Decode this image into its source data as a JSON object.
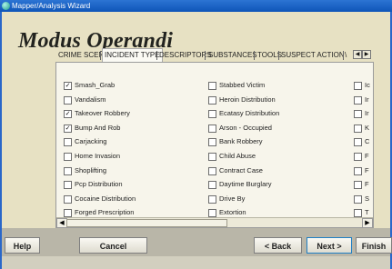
{
  "window": {
    "title": "Mapper/Analysis Wizard"
  },
  "heading": "Modus Operandi",
  "tabs": [
    "CRIME SCENE",
    "INCIDENT TYPE",
    "DESCRIPTORS",
    "SUBSTANCES",
    "TOOLS",
    "SUSPECT ACTION",
    "\\"
  ],
  "selected_tab": "INCIDENT TYPE",
  "column1": [
    {
      "label": "Smash_Grab",
      "checked": true
    },
    {
      "label": "Vandalism",
      "checked": false
    },
    {
      "label": "Takeover Robbery",
      "checked": true
    },
    {
      "label": "Bump And Rob",
      "checked": true
    },
    {
      "label": "Carjacking",
      "checked": false
    },
    {
      "label": "Home Invasion",
      "checked": false
    },
    {
      "label": "Shoplifting",
      "checked": false
    },
    {
      "label": "Pcp Distribution",
      "checked": false
    },
    {
      "label": "Cocaine Distribution",
      "checked": false
    },
    {
      "label": "Forged Prescription",
      "checked": false
    }
  ],
  "column2": [
    {
      "label": "Stabbed Victim",
      "checked": false
    },
    {
      "label": "Heroin Distribution",
      "checked": false
    },
    {
      "label": "Ecatasy Distribution",
      "checked": false
    },
    {
      "label": "Arson - Occupied",
      "checked": false
    },
    {
      "label": "Bank Robbery",
      "checked": false
    },
    {
      "label": "Child Abuse",
      "checked": false
    },
    {
      "label": "Contract Case",
      "checked": false
    },
    {
      "label": "Daytime Burglary",
      "checked": false
    },
    {
      "label": "Drive By",
      "checked": false
    },
    {
      "label": "Extortion",
      "checked": false
    }
  ],
  "column3": [
    {
      "label": "Ic",
      "checked": false
    },
    {
      "label": "Ir",
      "checked": false
    },
    {
      "label": "Ir",
      "checked": false
    },
    {
      "label": "K",
      "checked": false
    },
    {
      "label": "C",
      "checked": false
    },
    {
      "label": "F",
      "checked": false
    },
    {
      "label": "F",
      "checked": false
    },
    {
      "label": "F",
      "checked": false
    },
    {
      "label": "S",
      "checked": false
    },
    {
      "label": "T",
      "checked": false
    }
  ],
  "buttons": {
    "help": "Help",
    "cancel": "Cancel",
    "back": "< Back",
    "next": "Next >",
    "finish": "Finish"
  }
}
